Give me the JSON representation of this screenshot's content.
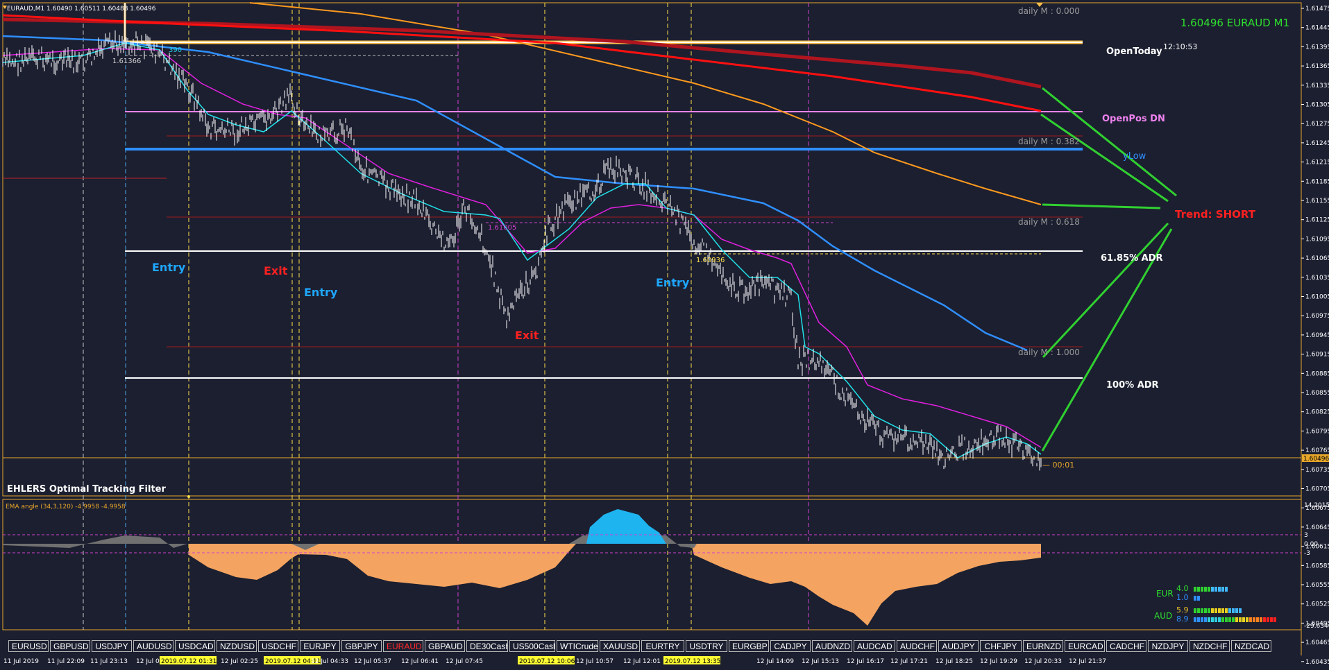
{
  "header": {
    "symbol_info": "EURAUD,M1  1.60490 1.60511 1.60488 1.60496",
    "price_title": "1.60496 EURAUD M1",
    "server_time": "12:10:53"
  },
  "levels": [
    {
      "label": "daily M : 0.000",
      "color": "#9a9a9a"
    },
    {
      "label": "OpenToday",
      "color": "#ffffff"
    },
    {
      "label": "OpenPos DN",
      "color": "#ee82ee"
    },
    {
      "label": "daily M : 0.382",
      "color": "#9a9a9a"
    },
    {
      "label": "yLow",
      "color": "#2f8fff"
    },
    {
      "label": "daily M : 0.618",
      "color": "#9a9a9a"
    },
    {
      "label": "61.85% ADR",
      "color": "#ffffff"
    },
    {
      "label": "daily M : 1.000",
      "color": "#9a9a9a"
    },
    {
      "label": "100% ADR",
      "color": "#ffffff"
    }
  ],
  "trend_label": "Trend: SHORT",
  "signals": [
    {
      "text": "Entry",
      "color": "#1ea7ff"
    },
    {
      "text": "Exit",
      "color": "#ff2020"
    },
    {
      "text": "Entry",
      "color": "#1ea7ff"
    },
    {
      "text": "Exit",
      "color": "#ff2020"
    },
    {
      "text": "Entry",
      "color": "#1ea7ff"
    }
  ],
  "chart_labels": {
    "price_marker_1": "1.61366",
    "price_marker_2": "1.61005",
    "price_marker_3": "1.60936",
    "dash_marker_1": "390",
    "countdown": "— 00:01",
    "indicator_title": "EHLERS Optimal Tracking Filter",
    "subwindow_title": "EMA angle (34,3,120) -4.9958 -4.9958"
  },
  "price_axis": {
    "ticks": [
      "1.61475",
      "1.61445",
      "1.61395",
      "1.61365",
      "1.61335",
      "1.61305",
      "1.61275",
      "1.61245",
      "1.61215",
      "1.61185",
      "1.61155",
      "1.61125",
      "1.61095",
      "1.61065",
      "1.61035",
      "1.61005",
      "1.60975",
      "1.60945",
      "1.60915",
      "1.60885",
      "1.60855",
      "1.60825",
      "1.60795",
      "1.60765",
      "1.60735",
      "1.60705",
      "1.60675",
      "1.60645",
      "1.60615",
      "1.60585",
      "1.60555",
      "1.60525",
      "1.60495",
      "1.60465",
      "1.60435"
    ],
    "current": "1.60496"
  },
  "sub_axis": {
    "ticks": [
      "14.2015",
      "3",
      "0.00",
      "-3",
      "-29.6346"
    ]
  },
  "strength": {
    "rows": [
      {
        "currency": "EUR",
        "v1": "4.0",
        "v2": "1.0"
      },
      {
        "currency": "AUD",
        "v1": "5.9",
        "v2": "8.9"
      }
    ]
  },
  "time_axis": {
    "labels": [
      "11 Jul 2019",
      "11 Jul 22:09",
      "11 Jul 23:13",
      "12 Jul 00:17",
      "2019.07.12 01:31",
      "12 Jul 02:25",
      "2019.07.12 04:11",
      "12 Jul 04:33",
      "12 Jul 05:37",
      "12 Jul 06:41",
      "12 Jul 07:45",
      "2019.07.12 10:06",
      "12 Jul 10:57",
      "12 Jul 12:01",
      "2019.07.12 13:35",
      "12 Jul 14:09",
      "12 Jul 15:13",
      "12 Jul 16:17",
      "12 Jul 17:21",
      "12 Jul 18:25",
      "12 Jul 19:29",
      "12 Jul 20:33",
      "12 Jul 21:37"
    ]
  },
  "symbols": [
    {
      "label": "EURUSD",
      "active": false
    },
    {
      "label": "GBPUSD",
      "active": false
    },
    {
      "label": "USDJPY",
      "active": false
    },
    {
      "label": "AUDUSD",
      "active": false
    },
    {
      "label": "USDCAD",
      "active": false
    },
    {
      "label": "NZDUSD",
      "active": false
    },
    {
      "label": "USDCHF",
      "active": false
    },
    {
      "label": "EURJPY",
      "active": false
    },
    {
      "label": "GBPJPY",
      "active": false
    },
    {
      "label": "EURAUD",
      "active": true
    },
    {
      "label": "GBPAUD",
      "active": false
    },
    {
      "label": "DE30Cash",
      "active": false
    },
    {
      "label": "US500Cash",
      "active": false
    },
    {
      "label": "WTICrude",
      "active": false
    },
    {
      "label": "XAUUSD",
      "active": false
    },
    {
      "label": "EURTRY",
      "active": false
    },
    {
      "label": "USDTRY",
      "active": false
    },
    {
      "label": "EURGBP",
      "active": false
    },
    {
      "label": "CADJPY",
      "active": false
    },
    {
      "label": "AUDNZD",
      "active": false
    },
    {
      "label": "AUDCAD",
      "active": false
    },
    {
      "label": "AUDCHF",
      "active": false
    },
    {
      "label": "AUDJPY",
      "active": false
    },
    {
      "label": "CHFJPY",
      "active": false
    },
    {
      "label": "EURNZD",
      "active": false
    },
    {
      "label": "EURCAD",
      "active": false
    },
    {
      "label": "CADCHF",
      "active": false
    },
    {
      "label": "NZDJPY",
      "active": false
    },
    {
      "label": "NZDCHF",
      "active": false
    },
    {
      "label": "NZDCAD",
      "active": false
    }
  ]
}
